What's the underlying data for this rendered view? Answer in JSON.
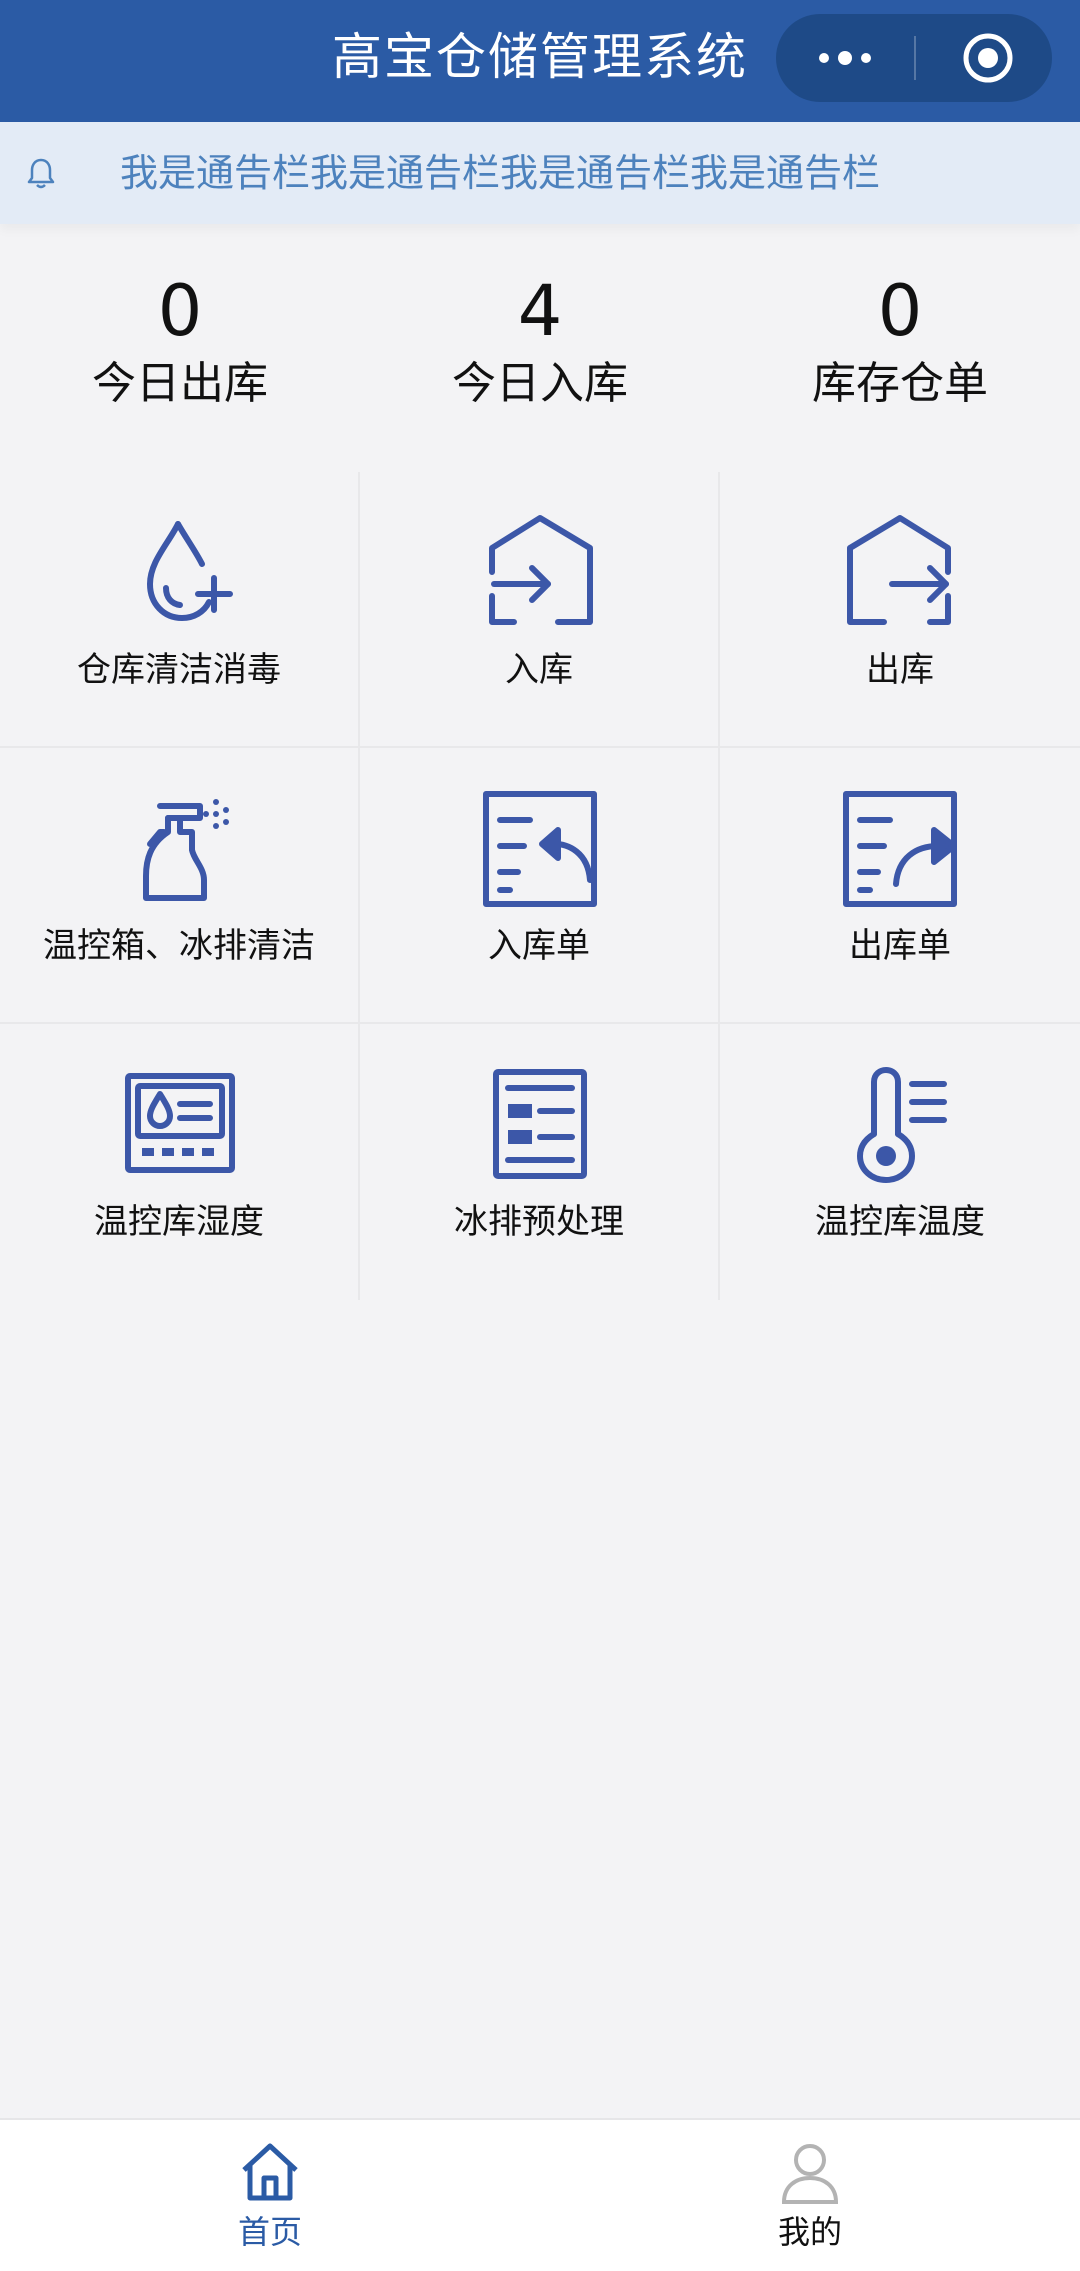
{
  "header": {
    "title": "高宝仓储管理系统",
    "more_icon": "more-dots-icon",
    "close_icon": "miniprogram-close-icon",
    "background": "#2b5ba5"
  },
  "notice": {
    "icon": "bell-icon",
    "text": "我是通告栏我是通告栏我是通告栏我是通告栏",
    "text_color": "#4d82bd"
  },
  "stats": [
    {
      "value": "0",
      "label": "今日出库"
    },
    {
      "value": "4",
      "label": "今日入库"
    },
    {
      "value": "0",
      "label": "库存仓单"
    }
  ],
  "grid": {
    "accent": "#3c57a8",
    "items": [
      {
        "label": "仓库清洁消毒",
        "icon": "water-drop-plus-icon"
      },
      {
        "label": "入库",
        "icon": "house-arrow-in-icon"
      },
      {
        "label": "出库",
        "icon": "house-arrow-out-icon"
      },
      {
        "label": "温控箱、冰排清洁",
        "icon": "spray-bottle-icon"
      },
      {
        "label": "入库单",
        "icon": "document-arrow-back-icon"
      },
      {
        "label": "出库单",
        "icon": "document-arrow-forward-icon"
      },
      {
        "label": "温控库湿度",
        "icon": "humidity-monitor-icon"
      },
      {
        "label": "冰排预处理",
        "icon": "form-panel-icon"
      },
      {
        "label": "温控库温度",
        "icon": "thermometer-icon"
      }
    ]
  },
  "tabbar": {
    "active_color": "#2b5ba5",
    "inactive_color": "#b3b3b3",
    "tabs": [
      {
        "label": "首页",
        "icon": "home-icon",
        "active": true
      },
      {
        "label": "我的",
        "icon": "user-icon",
        "active": false
      }
    ]
  }
}
